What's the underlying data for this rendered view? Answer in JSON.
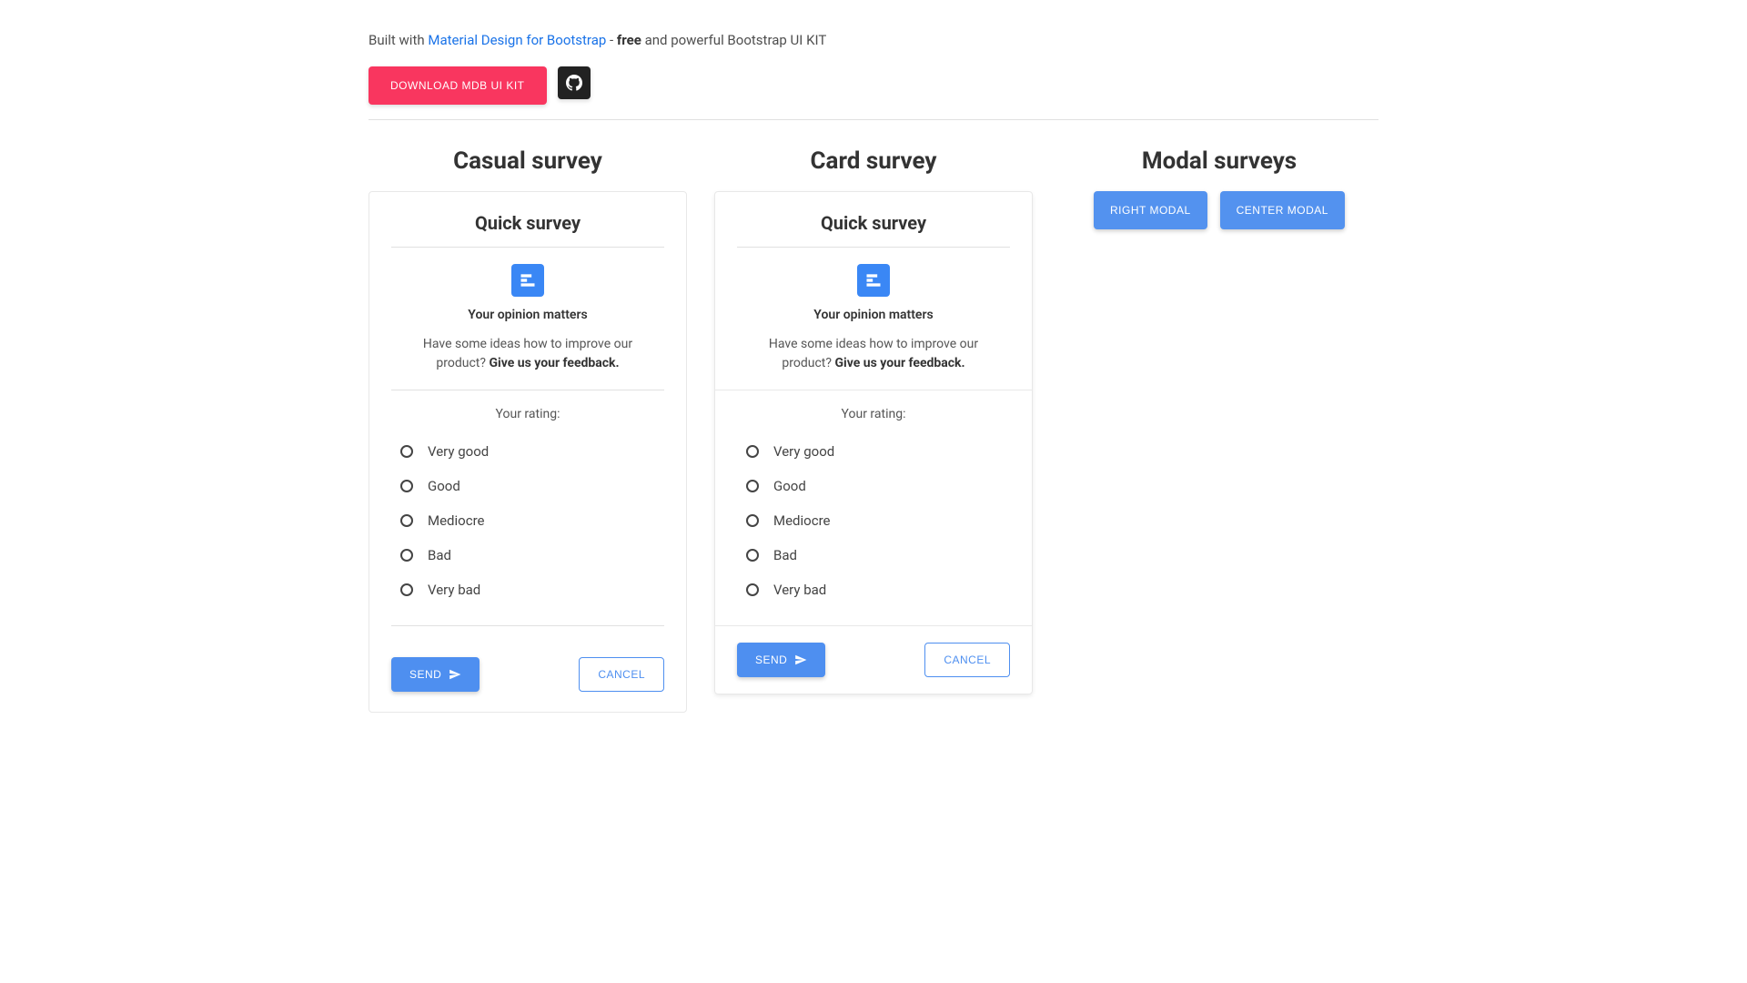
{
  "header": {
    "built_prefix": "Built with ",
    "link_text": "Material Design for Bootstrap",
    "dash": " - ",
    "free": "free",
    "suffix": " and powerful Bootstrap UI KIT"
  },
  "buttons": {
    "download": "DOWNLOAD MDB UI KIT"
  },
  "sections": {
    "casual": "Casual survey",
    "card": "Card survey",
    "modal": "Modal surveys"
  },
  "survey": {
    "title": "Quick survey",
    "subtitle": "Your opinion matters",
    "desc_prefix": "Have some ideas how to improve our product? ",
    "desc_bold": "Give us your feedback.",
    "rating_label": "Your rating:",
    "options": [
      "Very good",
      "Good",
      "Mediocre",
      "Bad",
      "Very bad"
    ],
    "send": "SEND",
    "cancel": "CANCEL"
  },
  "modal_btns": {
    "right": "RIGHT MODAL",
    "center": "CENTER MODAL"
  }
}
